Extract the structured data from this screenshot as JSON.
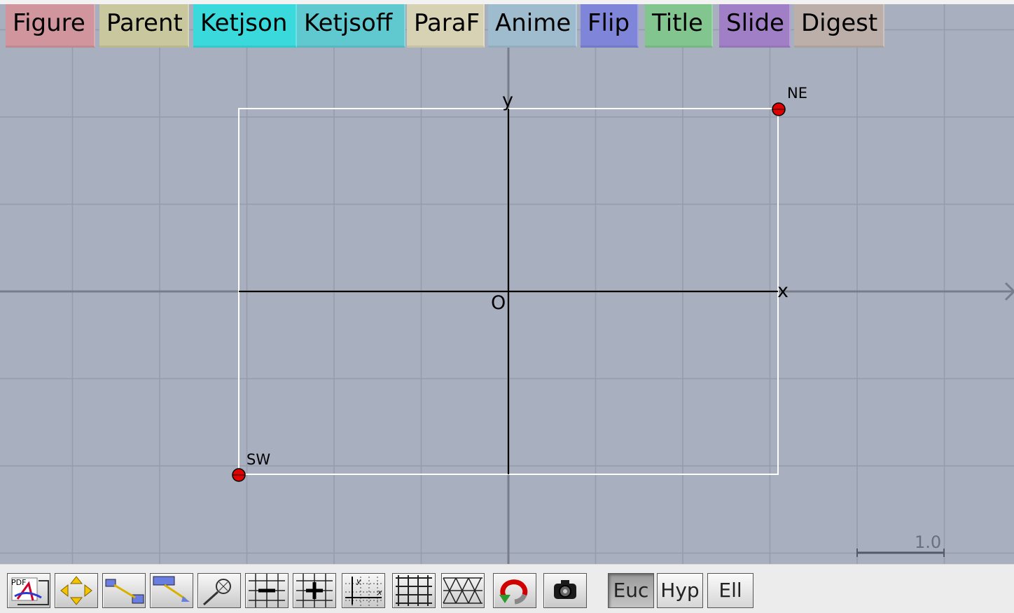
{
  "tabs": [
    {
      "label": "Figure",
      "color": "#d0959d"
    },
    {
      "label": "Parent",
      "color": "#c9c79d"
    },
    {
      "label": "Ketjson",
      "color": "#39d9dc"
    },
    {
      "label": "Ketjsoff",
      "color": "#5fc9cf"
    },
    {
      "label": "ParaF",
      "color": "#d8d2b4"
    },
    {
      "label": "Anime",
      "color": "#9fbcce"
    },
    {
      "label": "Flip",
      "color": "#7f85d8"
    },
    {
      "label": "Title",
      "color": "#82c58f"
    },
    {
      "label": "Slide",
      "color": "#a17fc6"
    },
    {
      "label": "Digest",
      "color": "#bcafaa"
    }
  ],
  "figure": {
    "x_label": "x",
    "y_label": "y",
    "origin_label": "O",
    "points": [
      {
        "label": "NE",
        "color": "#e00000"
      },
      {
        "label": "SW",
        "color": "#e00000"
      }
    ],
    "scale_label": "1.0",
    "background": "#a8afbe",
    "frame_color": "#ffffff"
  },
  "toolbar": {
    "icon_buttons": [
      "pdf-icon",
      "move-icon",
      "draw-segment-icon",
      "drag-segment-icon",
      "zoom-icon",
      "zoom-out-icon",
      "zoom-in-icon",
      "axes-icon",
      "grid-icon",
      "triangular-grid-icon",
      "undo-icon",
      "camera-icon"
    ],
    "geometry_buttons": [
      {
        "label": "Euc",
        "active": true
      },
      {
        "label": "Hyp",
        "active": false
      },
      {
        "label": "Ell",
        "active": false
      }
    ]
  }
}
